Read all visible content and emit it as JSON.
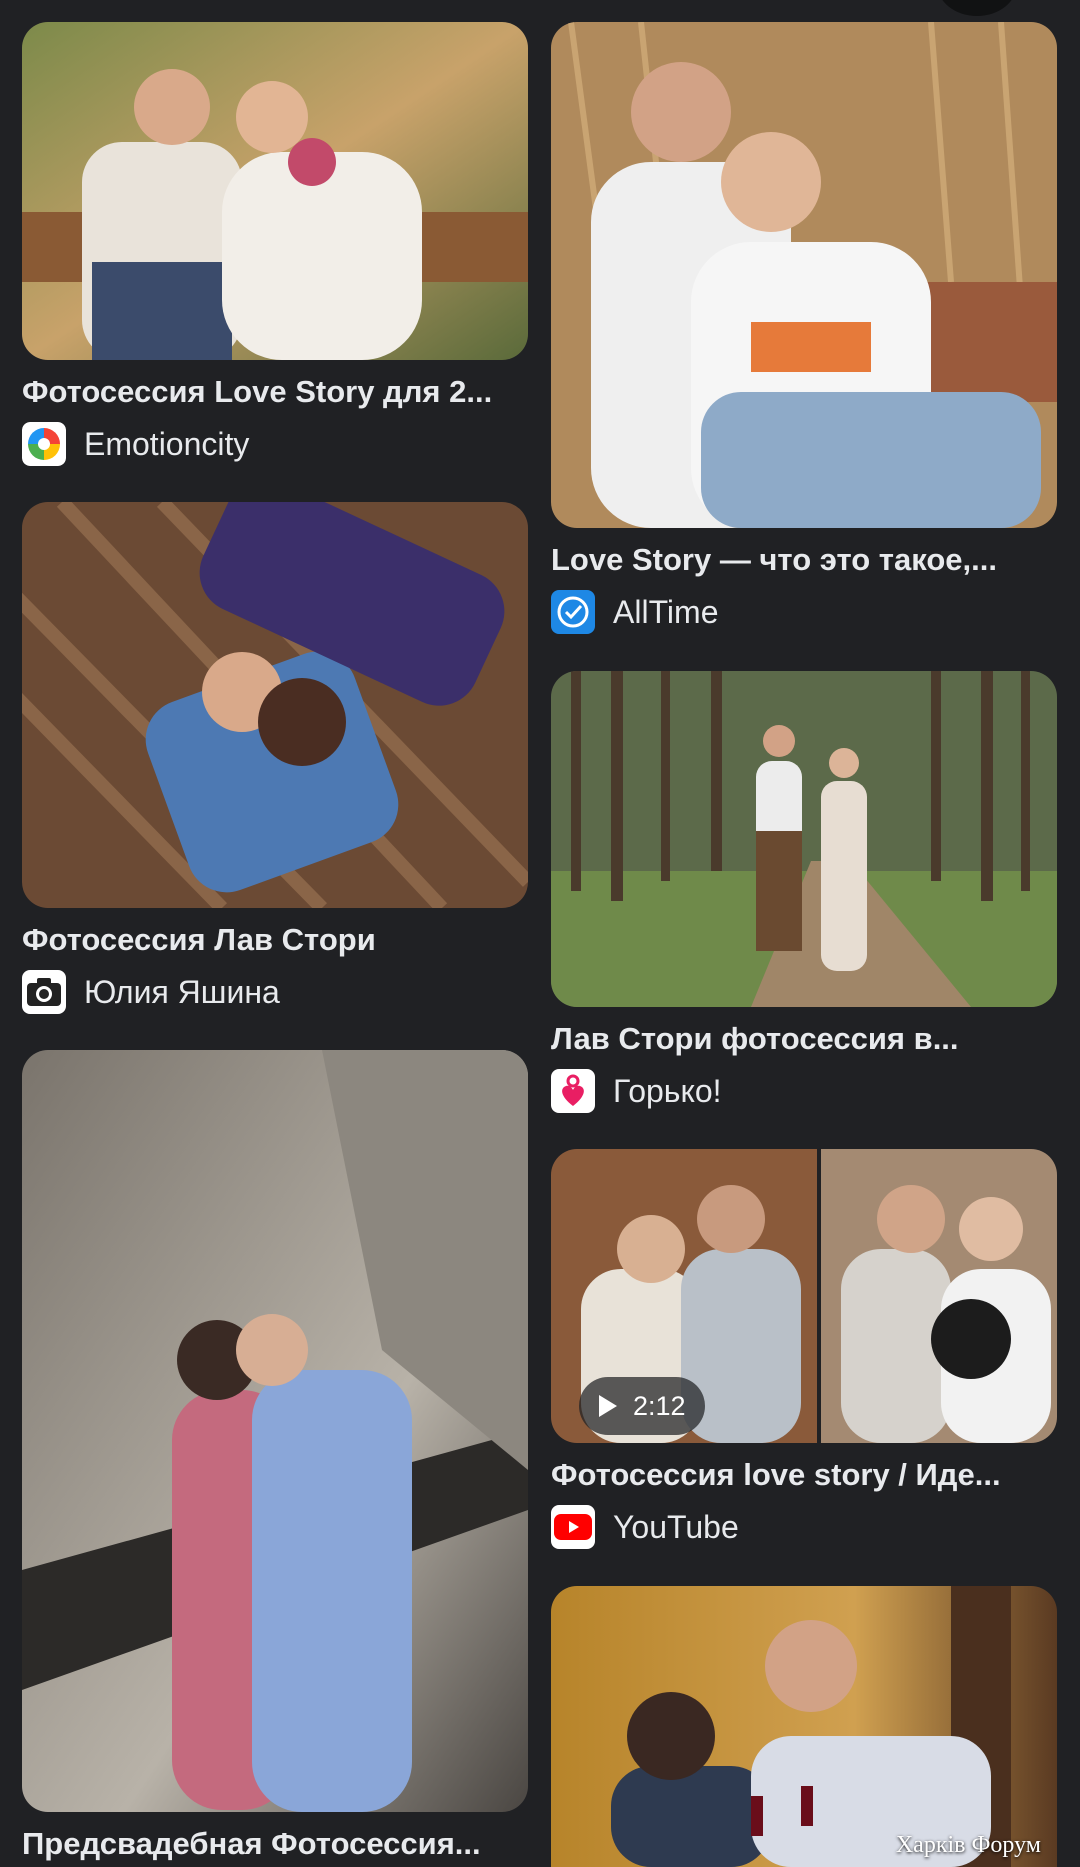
{
  "results": {
    "left": [
      {
        "title": "Фотосессия Love Story для 2...",
        "source": "Emotioncity",
        "icon": "emotioncity-logo-icon"
      },
      {
        "title": "Фотосессия Лав Стори",
        "source": "Юлия Яшина",
        "icon": "camera-icon"
      },
      {
        "title": "Предсвадебная Фотосессия...",
        "source": "",
        "icon": ""
      }
    ],
    "right": [
      {
        "title": "Love Story — что это такое,...",
        "source": "AllTime",
        "icon": "alltime-clock-icon"
      },
      {
        "title": "Лав Стори фотосессия в...",
        "source": "Горько!",
        "icon": "gorko-heart-icon"
      },
      {
        "title": "Фотосессия love story / Иде...",
        "source": "YouTube",
        "icon": "youtube-play-icon",
        "duration": "2:12"
      },
      {
        "title": "",
        "source": "",
        "watermark": "Харків Форум"
      }
    ]
  },
  "colors": {
    "background": "#202124",
    "text": "#e8eaed",
    "youtube_red": "#ff0000",
    "alltime_blue": "#1e88e5",
    "gorko_pink": "#e91e63"
  }
}
